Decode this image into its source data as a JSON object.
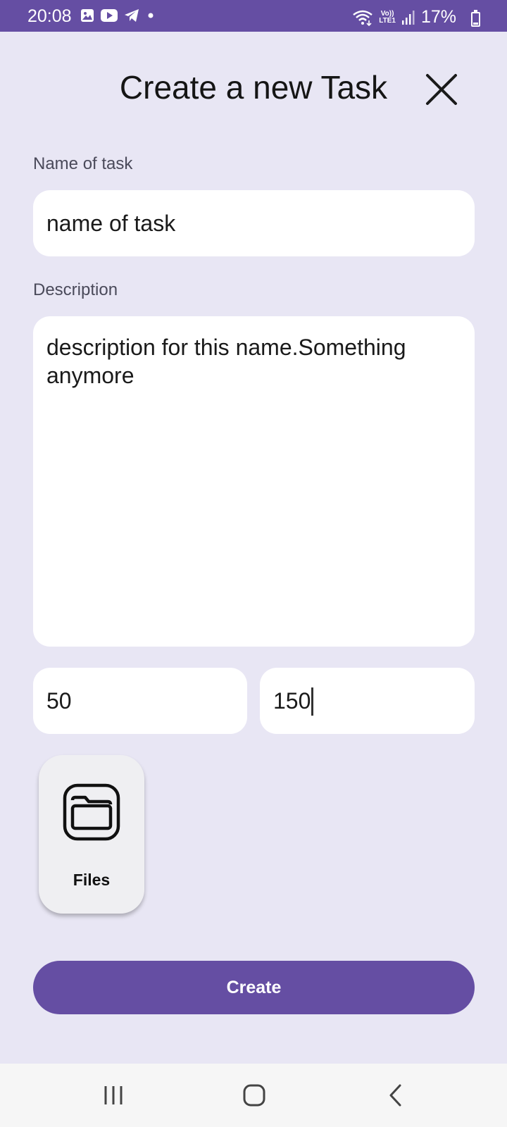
{
  "status_bar": {
    "time": "20:08",
    "battery_percent": "17%",
    "battery_level": 0.17,
    "network_line1": "Vo))",
    "network_line2": "LTE1",
    "icons": [
      "gallery-icon",
      "youtube-icon",
      "telegram-icon",
      "dot-icon",
      "wifi-icon",
      "signal-icon",
      "battery-icon"
    ]
  },
  "header": {
    "title": "Create a new Task",
    "close_icon": "close-icon"
  },
  "form": {
    "name_label": "Name of task",
    "name_value": "name of task",
    "description_label": "Description",
    "description_value": "description for this name.Something anymore",
    "field_a_value": "50",
    "field_b_value": "150"
  },
  "attachments": {
    "files_label": "Files",
    "files_icon": "folder-icon"
  },
  "actions": {
    "create_label": "Create"
  },
  "nav": {
    "recents_icon": "recents-icon",
    "home_icon": "home-icon",
    "back_icon": "back-icon"
  },
  "colors": {
    "accent": "#654ea3",
    "background": "#e8e6f4",
    "field_bg": "#ffffff"
  }
}
